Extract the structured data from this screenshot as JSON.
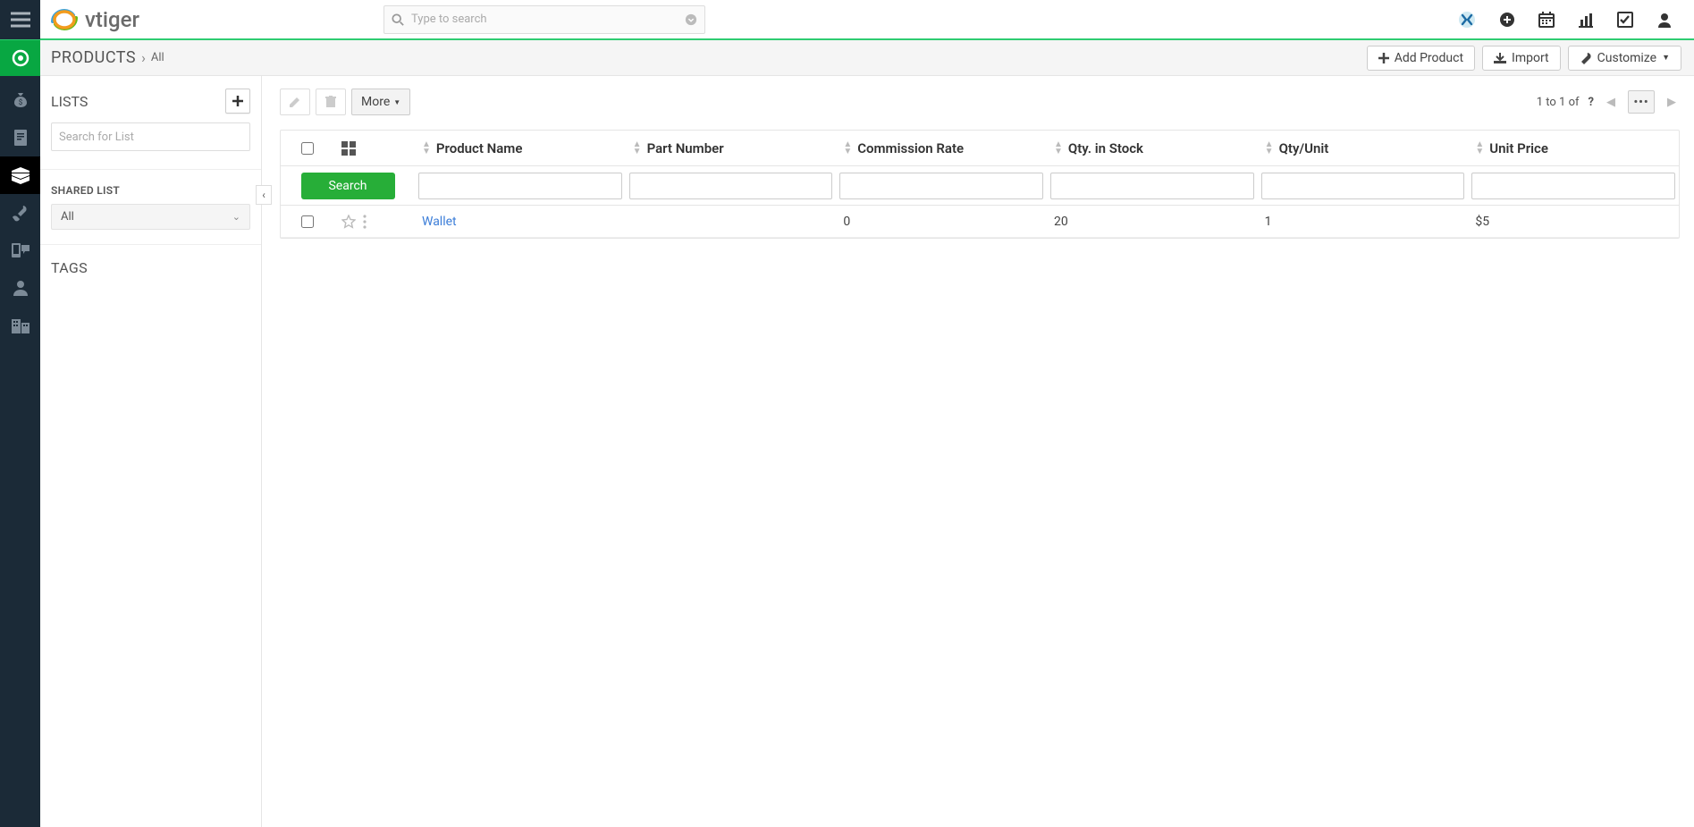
{
  "header": {
    "search_placeholder": "Type to search"
  },
  "module": {
    "name": "PRODUCTS",
    "crumb": "All",
    "add_label": "Add Product",
    "import_label": "Import",
    "customize_label": "Customize"
  },
  "sidebar": {
    "lists_heading": "LISTS",
    "search_placeholder": "Search for List",
    "shared_heading": "SHARED LIST",
    "shared_value": "All",
    "tags_heading": "TAGS"
  },
  "toolbar": {
    "more_label": "More",
    "pager_text": "1 to 1  of",
    "pager_q": "?"
  },
  "table": {
    "columns": {
      "product_name": "Product Name",
      "part_number": "Part Number",
      "commission_rate": "Commission Rate",
      "qty_in_stock": "Qty. in Stock",
      "qty_unit": "Qty/Unit",
      "unit_price": "Unit Price"
    },
    "search_button": "Search",
    "rows": [
      {
        "product_name": "Wallet",
        "part_number": "",
        "commission_rate": "0",
        "qty_in_stock": "20",
        "qty_unit": "1",
        "unit_price": "$5"
      }
    ]
  }
}
